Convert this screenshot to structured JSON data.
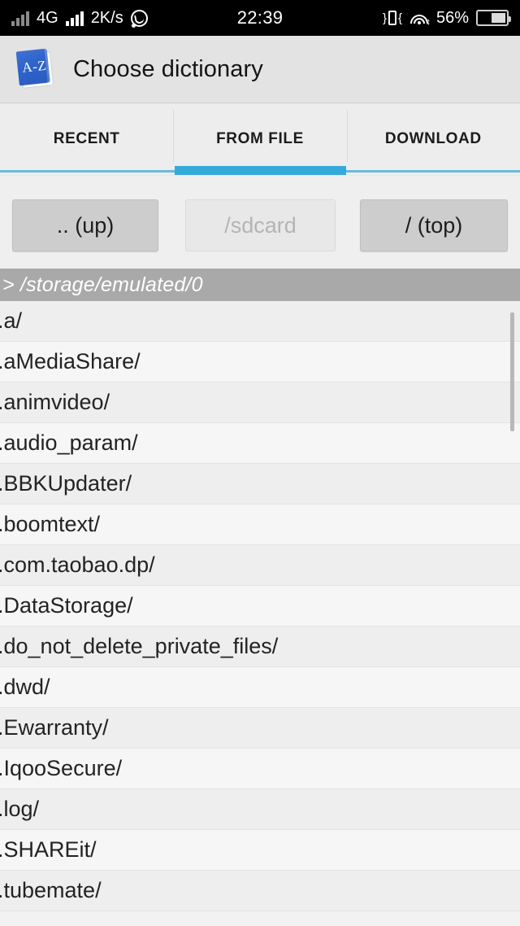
{
  "status_bar": {
    "signal_label": "4G",
    "network_speed": "2K/s",
    "clock": "22:39",
    "battery_percent": "56%",
    "icons": [
      "signal-bars-icon",
      "signal-bars-icon",
      "whatsapp-icon",
      "vibrate-icon",
      "wifi-icon",
      "battery-icon"
    ]
  },
  "header": {
    "title": "Choose dictionary",
    "icon": "dictionary-book-icon",
    "icon_text": "A-Z"
  },
  "tabs": [
    {
      "label": "RECENT",
      "selected": false
    },
    {
      "label": "FROM FILE",
      "selected": true
    },
    {
      "label": "DOWNLOAD",
      "selected": false
    }
  ],
  "accent_color": "#35aada",
  "nav_buttons": [
    {
      "label": ".. (up)",
      "enabled": true
    },
    {
      "label": "/sdcard",
      "enabled": false
    },
    {
      "label": "/ (top)",
      "enabled": true
    }
  ],
  "path_bar": {
    "text": "> /storage/emulated/0"
  },
  "file_list": {
    "items": [
      ".a/",
      ".aMediaShare/",
      ".animvideo/",
      ".audio_param/",
      ".BBKUpdater/",
      ".boomtext/",
      ".com.taobao.dp/",
      ".DataStorage/",
      ".do_not_delete_private_files/",
      ".dwd/",
      ".Ewarranty/",
      ".IqooSecure/",
      ".log/",
      ".SHAREit/",
      ".tubemate/"
    ]
  }
}
